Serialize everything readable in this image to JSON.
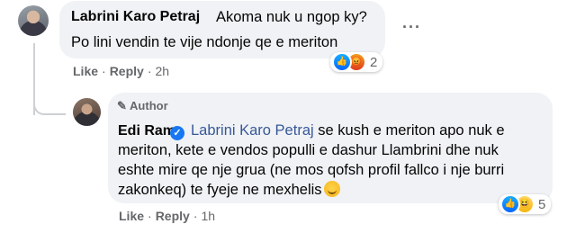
{
  "comments": [
    {
      "author": "Labrini Karo Petraj",
      "text_line1": "Akoma nuk u ngop ky?",
      "text_line2": "Po lini vendin te vije ndonje qe e meriton",
      "actions": {
        "like": "Like",
        "reply": "Reply",
        "time": "2h"
      },
      "reactions": {
        "icons": [
          "like-icon",
          "angry-icon"
        ],
        "count": "2"
      },
      "more": "···"
    },
    {
      "badge": "Author",
      "author": "Edi Rama",
      "verified": true,
      "mention": "Labrini Karo Petraj",
      "text_line1": "se kush e meriton apo nuk e",
      "text_line2": "meriton, kete e vendos populli e dashur Llambrini dhe nuk",
      "text_line3": "eshte mire qe nje grua (ne mos qofsh profil fallco i nje burri",
      "text_line4": "zakonkeq) te fyeje ne mexhelis",
      "actions": {
        "like": "Like",
        "reply": "Reply",
        "time": "1h"
      },
      "reactions": {
        "icons": [
          "like-icon",
          "haha-icon"
        ],
        "count": "5"
      }
    }
  ],
  "colors": {
    "bubble": "#f0f2f5",
    "mention": "#385898",
    "meta": "#65676b",
    "verified": "#1877f2"
  }
}
